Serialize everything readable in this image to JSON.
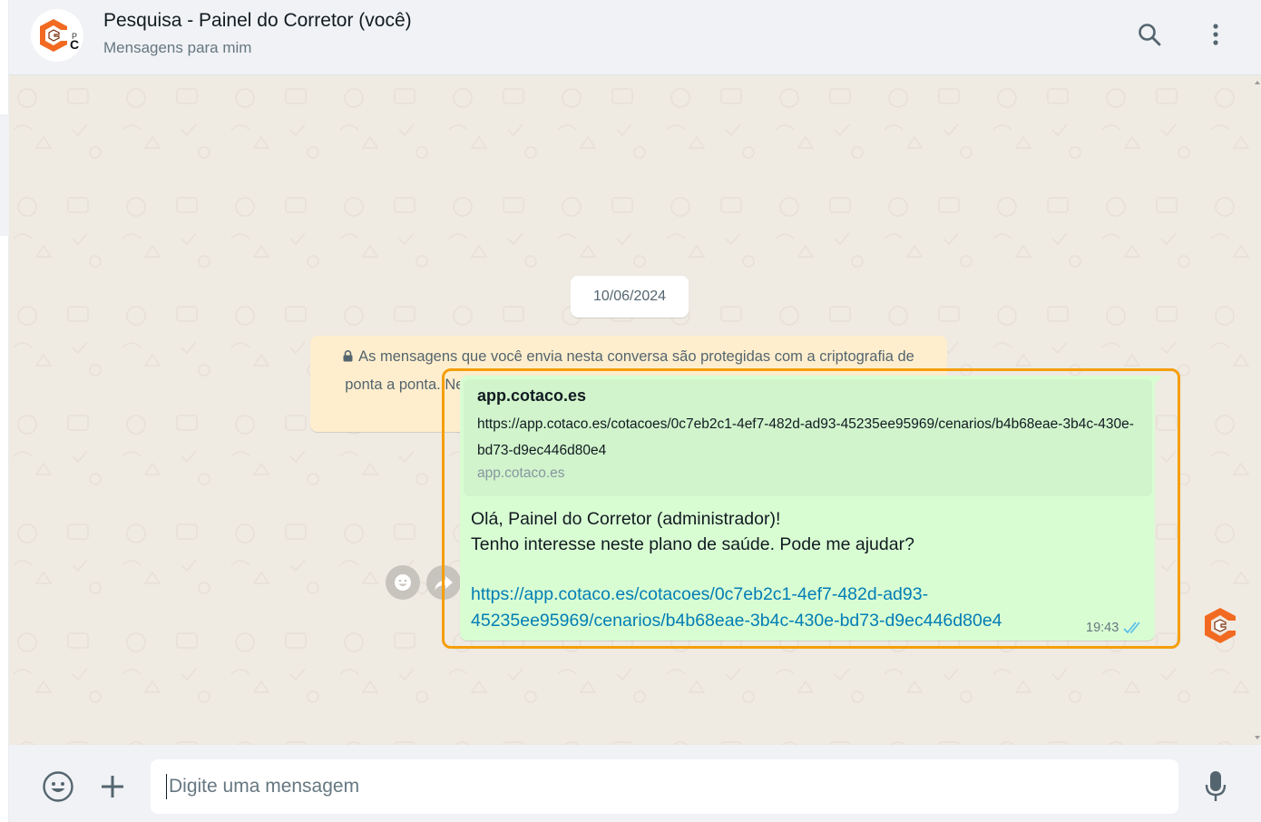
{
  "header": {
    "title": "Pesquisa - Painel do Corretor (você)",
    "subtitle": "Mensagens para mim",
    "avatar_icon": "cotaco-logo-icon",
    "actions": [
      {
        "icon": "search-icon"
      },
      {
        "icon": "kebab-menu-icon"
      }
    ]
  },
  "chat": {
    "date_chip": "10/06/2024",
    "encryption_notice": "As mensagens que você envia nesta conversa são protegidas com a criptografia de ponta a ponta. Nem mesmo o WhatsApp pode ler ou ouvi-las. Clique para saber mais",
    "message": {
      "preview": {
        "title": "app.cotaco.es",
        "description": "https://app.cotaco.es/cotacoes/0c7eb2c1-4ef7-482d-ad93-45235ee95969/cenarios/b4b68eae-3b4c-430e-bd73-d9ec446d80e4",
        "domain": "app.cotaco.es"
      },
      "text": "Olá, Painel do Corretor  (administrador)!\nTenho interesse neste plano de saúde. Pode me ajudar?",
      "link": "https://app.cotaco.es/cotacoes/0c7eb2c1-4ef7-482d-ad93-45235ee95969/cenarios/b4b68eae-3b4c-430e-bd73-d9ec446d80e4",
      "time": "19:43",
      "status_icon": "double-check-icon",
      "highlight_color": "#f59e0b"
    },
    "hover_actions": [
      {
        "icon": "emoji-reaction-icon"
      },
      {
        "icon": "forward-icon"
      }
    ]
  },
  "footer": {
    "input_placeholder": "Digite uma mensagem",
    "input_value": "",
    "icons": [
      "emoji-icon",
      "plus-icon",
      "microphone-icon"
    ]
  },
  "colors": {
    "header_bg": "#f0f2f5",
    "chat_bg": "#efeae2",
    "bubble_out": "#d9fdd3",
    "notice_bg": "#ffeecd",
    "link": "#027eb5",
    "brand_orange": "#f26a21"
  }
}
